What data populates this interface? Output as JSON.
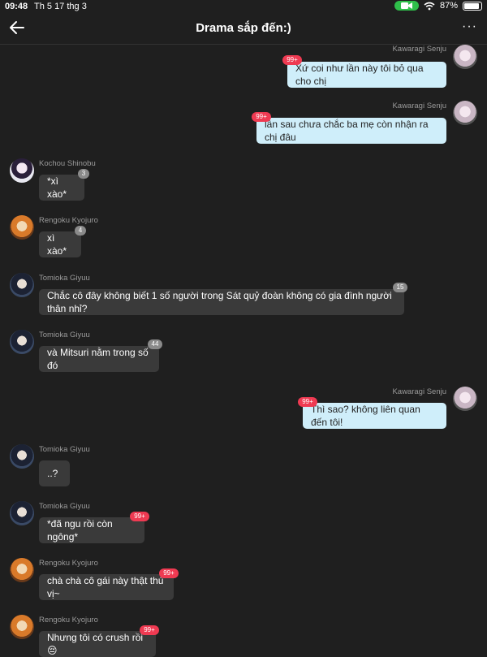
{
  "status_bar": {
    "time": "09:48",
    "date": "Th 5 17 thg 3",
    "battery": "87%"
  },
  "header": {
    "title": "Drama sắp đến:)",
    "more": "···"
  },
  "messages": [
    {
      "sender": "Kawaragi Senju",
      "text": "Xứ coi như lần này tôi bỏ qua cho chị",
      "count": "99+"
    },
    {
      "sender": "Kawaragi Senju",
      "text": "lần sau chưa chắc ba mẹ còn nhận ra chị đâu",
      "count": "99+"
    },
    {
      "sender": "Kochou Shinobu",
      "text": "*xì xào*",
      "count": "3"
    },
    {
      "sender": "Rengoku Kyojuro",
      "text": "xì xào*",
      "count": "4"
    },
    {
      "sender": "Tomioka Giyuu",
      "text": "Chắc cô đây không biết 1 số người trong Sát quỷ đoàn không có gia đình người thân nhỉ?",
      "count": "15"
    },
    {
      "sender": "Tomioka Giyuu",
      "text": "và Mitsuri nằm trong số đó",
      "count": "44"
    },
    {
      "sender": "Kawaragi Senju",
      "text": "Thì sao? không liên quan đến tôi!",
      "count": "99+"
    },
    {
      "sender": "Tomioka Giyuu",
      "text": "..?",
      "count": ""
    },
    {
      "sender": "Tomioka Giyuu",
      "text": "*đã ngu rồi còn ngông*",
      "count": "99+"
    },
    {
      "sender": "Rengoku Kyojuro",
      "text": "chà chà cô gái này thật thú vị~",
      "count": "99+"
    },
    {
      "sender": "Rengoku Kyojuro",
      "text": "Nhưng tôi có crush rồi 😔",
      "count": "99+"
    }
  ],
  "colors": {
    "background": "#1f1f1f",
    "incoming_bubble": "#3a3a3a",
    "outgoing_bubble": "#cfeefa",
    "badge_red": "#ef3a52",
    "badge_grey": "#8a8a8a",
    "status_camera": "#2fbf4a"
  },
  "icons": [
    "back-arrow-icon",
    "more-icon",
    "camera-icon",
    "wifi-icon",
    "battery-icon"
  ]
}
